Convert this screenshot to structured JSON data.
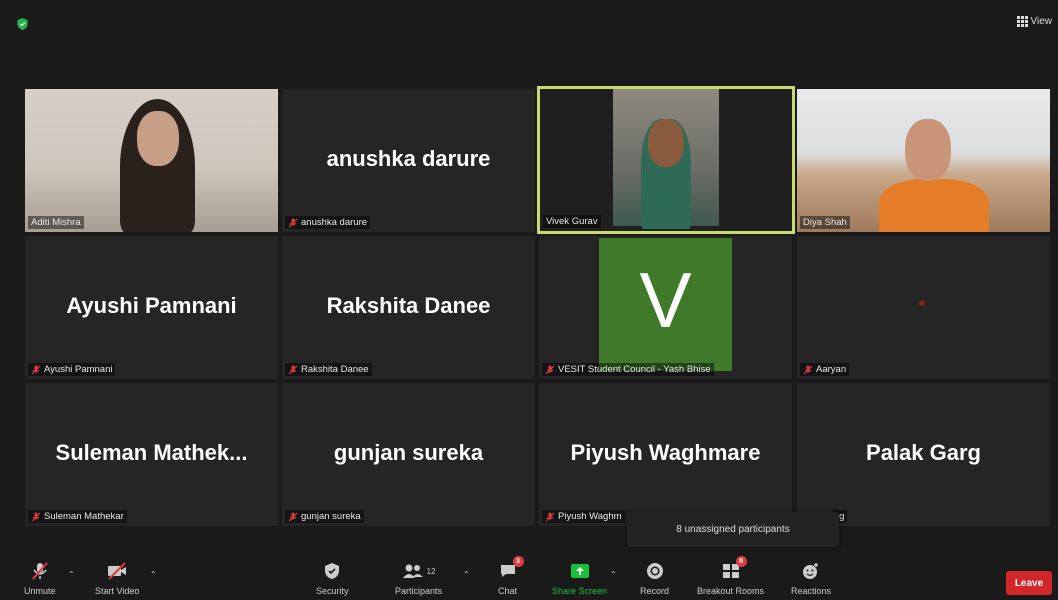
{
  "topbar": {
    "view_label": "View"
  },
  "tiles": [
    {
      "display_name": "",
      "label": "Aditi Mishra",
      "muted": false
    },
    {
      "display_name": "anushka darure",
      "label": "anushka darure",
      "muted": true
    },
    {
      "display_name": "",
      "label": "Vivek Gurav",
      "muted": false,
      "active_speaker": true
    },
    {
      "display_name": "",
      "label": "Diya Shah",
      "muted": false
    },
    {
      "display_name": "Ayushi Pamnani",
      "label": "Ayushi Pamnani",
      "muted": true
    },
    {
      "display_name": "Rakshita Danee",
      "label": "Rakshita Danee",
      "muted": true
    },
    {
      "display_name": "",
      "avatar_letter": "V",
      "label": "VESIT Student Council - Yash Bhise",
      "muted": true
    },
    {
      "display_name": "",
      "label": "Aaryan",
      "muted": true
    },
    {
      "display_name": "Suleman  Mathek...",
      "label": "Suleman Mathekar",
      "muted": true
    },
    {
      "display_name": "gunjan sureka",
      "label": "gunjan sureka",
      "muted": true
    },
    {
      "display_name": "Piyush Waghmare",
      "label": "Piyush Waghm",
      "muted": true
    },
    {
      "display_name": "Palak Garg",
      "label": "rg",
      "muted": false
    }
  ],
  "tooltip": "8 unassigned participants",
  "toolbar": {
    "unmute": "Unmute",
    "start_video": "Start Video",
    "security": "Security",
    "participants": "Participants",
    "participants_count": "12",
    "chat": "Chat",
    "chat_badge": "3",
    "share_screen": "Share Screen",
    "record": "Record",
    "breakout_rooms": "Breakout Rooms",
    "breakout_badge": "8",
    "reactions": "Reactions",
    "leave": "Leave"
  },
  "colors": {
    "active_border": "#c6dd6e",
    "share_green": "#17c23a",
    "leave_red": "#d1262a",
    "badge_red": "#e0393e",
    "avatar_green": "#3f7a2a"
  }
}
